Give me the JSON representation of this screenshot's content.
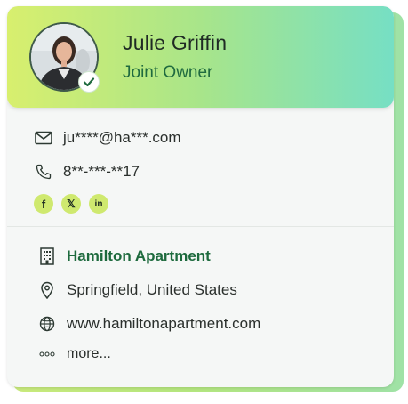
{
  "profile": {
    "name": "Julie Griffin",
    "role": "Joint Owner"
  },
  "contact": {
    "email": "ju****@ha***.com",
    "phone": "8**-***-**17"
  },
  "socials": [
    {
      "icon": "facebook-icon",
      "glyph": "f"
    },
    {
      "icon": "x-icon",
      "glyph": "𝕏"
    },
    {
      "icon": "linkedin-icon",
      "glyph": "in"
    }
  ],
  "company": {
    "name": "Hamilton Apartment",
    "location": "Springfield, United States",
    "website": "www.hamiltonapartment.com",
    "more_label": "more..."
  },
  "colors": {
    "header_gradient_start": "#d8ef6e",
    "header_gradient_end": "#76dfc4",
    "accent_green": "#1f6a3f",
    "social_bg": "#cfe96f"
  }
}
